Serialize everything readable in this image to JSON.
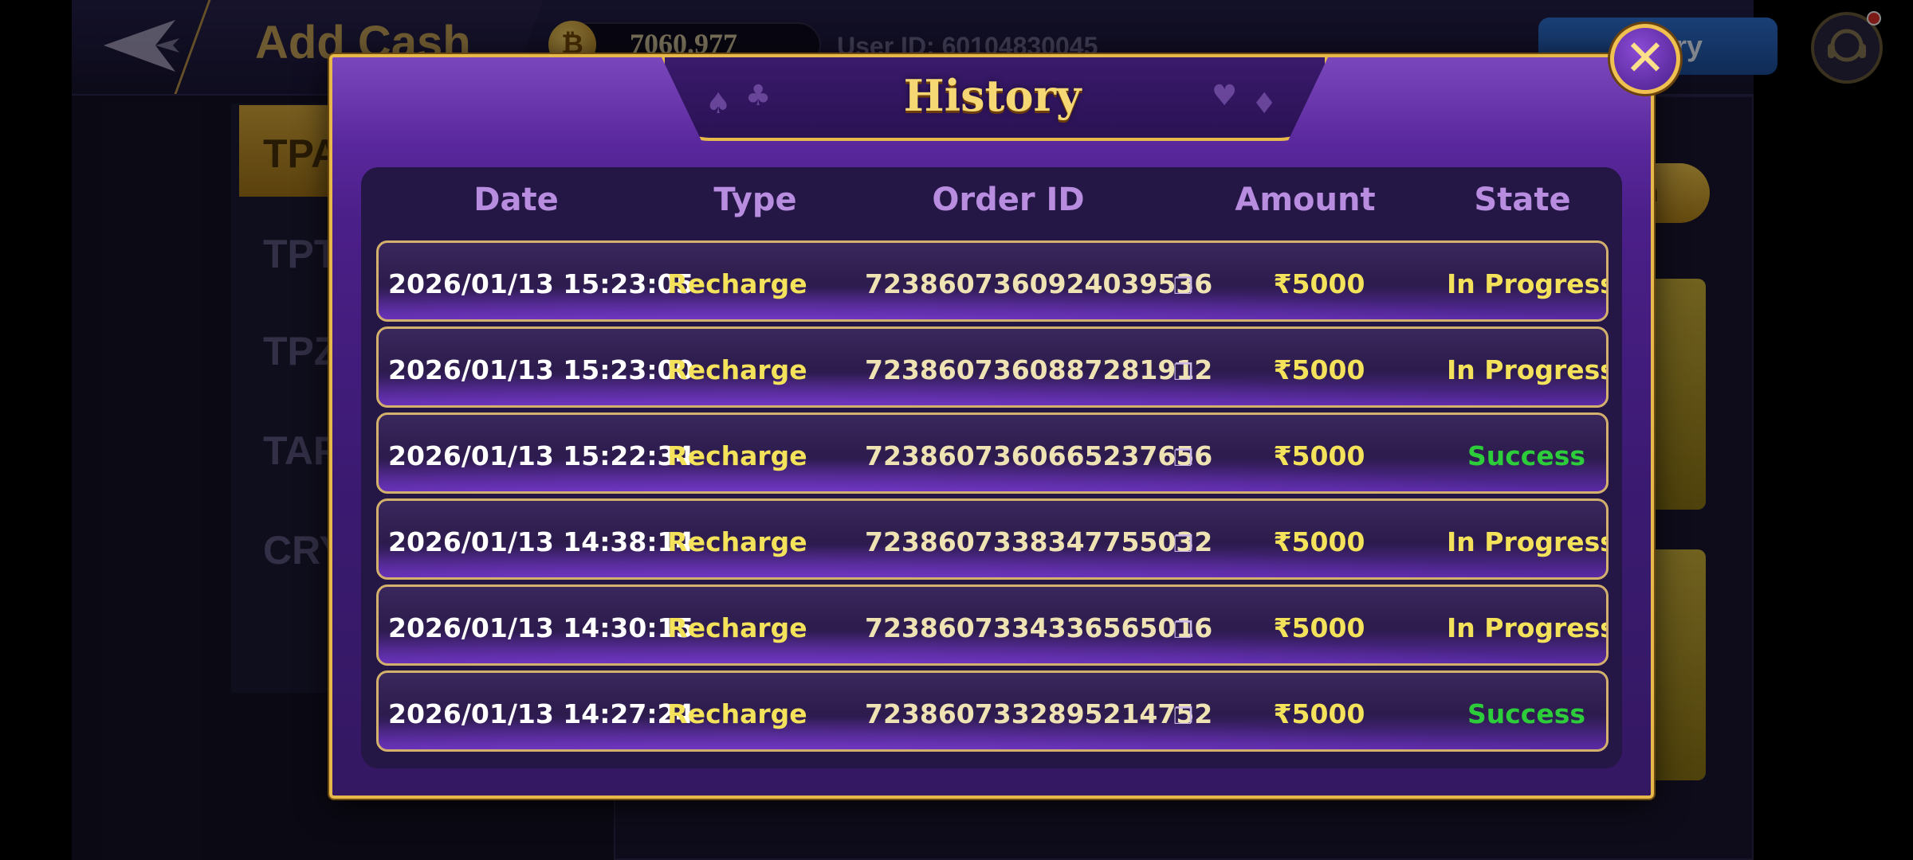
{
  "background": {
    "page_title": "Add Cash",
    "balance": "7060.977",
    "coin_symbol": "₿",
    "user_id": "User ID: 60104830045",
    "history_button_label": "ory",
    "sidebar_items": [
      "TPA",
      "TPT",
      "TPZ",
      "TAP",
      "CRY"
    ],
    "gold_button_label": "h"
  },
  "dialog": {
    "title": "History",
    "close_label": "✕",
    "columns": [
      "Date",
      "Type",
      "Order ID",
      "Amount",
      "State"
    ],
    "rows": [
      {
        "date": "2026/01/13 15:23:05",
        "type": "Recharge",
        "order_id": "7238607360924039536",
        "amount": "₹5000",
        "state": "In Progress"
      },
      {
        "date": "2026/01/13 15:23:00",
        "type": "Recharge",
        "order_id": "7238607360887281912",
        "amount": "₹5000",
        "state": "In Progress"
      },
      {
        "date": "2026/01/13 15:22:34",
        "type": "Recharge",
        "order_id": "7238607360665237656",
        "amount": "₹5000",
        "state": "Success"
      },
      {
        "date": "2026/01/13 14:38:14",
        "type": "Recharge",
        "order_id": "7238607338347755032",
        "amount": "₹5000",
        "state": "In Progress"
      },
      {
        "date": "2026/01/13 14:30:15",
        "type": "Recharge",
        "order_id": "7238607334336565016",
        "amount": "₹5000",
        "state": "In Progress"
      },
      {
        "date": "2026/01/13 14:27:24",
        "type": "Recharge",
        "order_id": "7238607332895214752",
        "amount": "₹5000",
        "state": "Success"
      }
    ]
  },
  "colors": {
    "state_in_progress": "#f4e35a",
    "state_success": "#2ccc3a",
    "dialog_border": "#e6b94a"
  }
}
